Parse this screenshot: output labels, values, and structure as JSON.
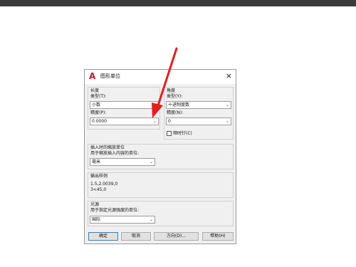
{
  "dialog": {
    "title": "图形单位",
    "close_glyph": "×",
    "app_icon_glyph": "A"
  },
  "length": {
    "heading": "长度",
    "type_label": "类型(T):",
    "type_value": "小数",
    "precision_label": "精度(P):",
    "precision_value": "0.0000"
  },
  "angle": {
    "heading": "角度",
    "type_label": "类型(Y):",
    "type_value": "十进制度数",
    "precision_label": "精度(N):",
    "precision_value": "0",
    "clockwise_label": "顺时针(C)"
  },
  "insert_scale": {
    "heading": "插入时的缩放单位",
    "desc": "用于缩放插入内容的单位:",
    "value": "毫米"
  },
  "sample": {
    "heading": "输出样例",
    "line1": "1.5,2.0039,0",
    "line2": "3<45,0"
  },
  "lighting": {
    "heading": "光源",
    "desc": "用于指定光源强度的单位:",
    "value": "国际"
  },
  "buttons": {
    "ok": "确定",
    "cancel": "取消",
    "direction": "方向(D)...",
    "help": "帮助(H)"
  },
  "chevron_glyph": "⌄",
  "colors": {
    "arrow": "#e02020",
    "brand": "#c8102e"
  }
}
